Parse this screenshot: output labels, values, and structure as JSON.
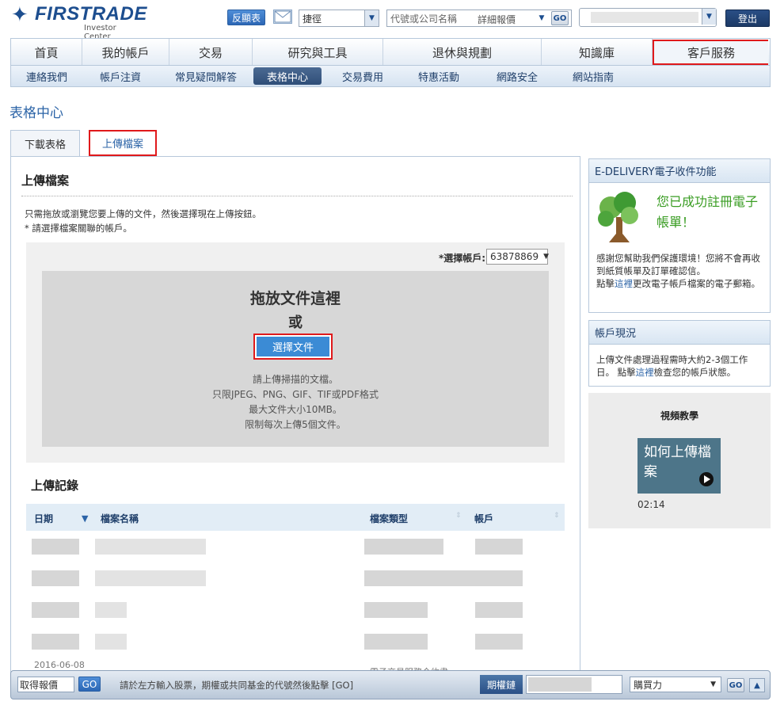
{
  "header": {
    "brand": "FIRSTRADE",
    "brand_sub": "Investor Center",
    "invert_label": "反顯表",
    "shortcut": "捷徑",
    "search_placeholder": "代號或公司名稱",
    "search_detail": "詳細報價",
    "go": "GO",
    "logout": "登出"
  },
  "main_nav": [
    "首頁",
    "我的帳戶",
    "交易",
    "研究與工具",
    "退休與規劃",
    "知識庫",
    "客戶服務"
  ],
  "sub_nav": [
    "連絡我們",
    "帳戶注資",
    "常見疑問解答",
    "表格中心",
    "交易費用",
    "特惠活動",
    "網路安全",
    "網站指南"
  ],
  "page_title": "表格中心",
  "tabs": {
    "download": "下載表格",
    "upload": "上傳檔案"
  },
  "upload": {
    "title": "上傳檔案",
    "intro1": "只需拖放或瀏覽您要上傳的文件，然後選擇現在上傳按鈕。",
    "intro2": "* 請選擇檔案關聯的帳戶。",
    "acct_label": "*選擇帳戶:",
    "acct_value": "63878869",
    "drop_title": "拖放文件這裡",
    "drop_or": "或",
    "choose_btn": "選擇文件",
    "note1": "請上傳掃描的文檔。",
    "note2": "只限JPEG、PNG、GIF、TIF或PDF格式",
    "note3": "最大文件大小10MB。",
    "note4": "限制每次上傳5個文件。"
  },
  "records": {
    "title": "上傳記錄",
    "columns": [
      "日期",
      "檔案名稱",
      "檔案類型",
      "帳戶"
    ],
    "partial_date": "2016-06-08",
    "partial_type": "電子交易服務合約書"
  },
  "sidebar": {
    "edelivery_title": "E-DELIVERY電子收件功能",
    "edelivery_msg": "您已成功註冊電子帳單！",
    "edelivery_text1": "感謝您幫助我們保護環境！您將不會再收到紙質帳單及訂單確認信。",
    "edelivery_text2_pre": "點擊",
    "edelivery_link": "這裡",
    "edelivery_text2_post": "更改電子帳戶檔案的電子郵箱。",
    "status_title": "帳戶現況",
    "status_text_pre": "上傳文件處理過程需時大約2-3個工作日。 點擊",
    "status_link": "這裡",
    "status_text_post": "檢查您的帳戶狀態。",
    "video_title": "視頻教學",
    "video_thumb": "如何上傳檔案",
    "video_duration": "02:14"
  },
  "bottom_bar": {
    "quote_label": "取得報價",
    "go": "GO",
    "hint": "請於左方輸入股票，期權或共同基金的代號然後點擊 [GO]",
    "options": "期權鏈",
    "buying_power": "購買力"
  },
  "colors": {
    "brand": "#1d4e8f",
    "highlight": "#e0191b",
    "link": "#2c64a7",
    "success": "#3a9d23"
  }
}
